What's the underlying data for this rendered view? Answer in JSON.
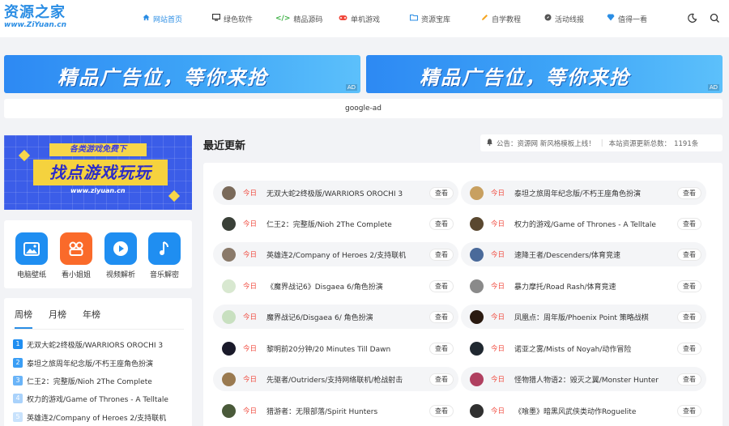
{
  "header": {
    "logo": {
      "cn": "资源之家",
      "en": "www.ZiYuan.cn"
    },
    "nav": [
      {
        "label": "网站首页",
        "icon": "home-icon",
        "active": true
      },
      {
        "label": "绿色软件",
        "icon": "monitor-icon"
      },
      {
        "label": "精品源码",
        "icon": "code-icon"
      },
      {
        "label": "单机游戏",
        "icon": "gamepad-icon"
      },
      {
        "label": "资源宝库",
        "icon": "folder-icon"
      },
      {
        "label": "自学教程",
        "icon": "pencil-icon"
      },
      {
        "label": "活动线报",
        "icon": "compass-icon"
      },
      {
        "label": "值得一看",
        "icon": "diamond-icon"
      }
    ]
  },
  "ads": {
    "text": "精品广告位，等你来抢",
    "tag": "AD",
    "google": "google-ad"
  },
  "sidebar": {
    "banner": {
      "strip": "各类游戏免费下",
      "title": "找点游戏玩玩",
      "url": "www.ziyuan.cn"
    },
    "tools": [
      {
        "label": "电脑壁纸",
        "icon": "image-icon",
        "color": "#1f8ef1"
      },
      {
        "label": "看小姐姐",
        "icon": "video-grid-icon",
        "color": "#fa6a2a"
      },
      {
        "label": "视频解析",
        "icon": "play-icon",
        "color": "#1f8ef1"
      },
      {
        "label": "音乐解密",
        "icon": "music-icon",
        "color": "#1f8ef1"
      }
    ],
    "rank_tabs": [
      "周榜",
      "月榜",
      "年榜"
    ],
    "rank_items": [
      {
        "num": "1",
        "title": "无双大蛇2终极版/WARRIORS OROCHI 3"
      },
      {
        "num": "2",
        "title": "泰坦之旅周年纪念版/不朽王座角色扮演"
      },
      {
        "num": "3",
        "title": "仁王2：完整版/Nioh 2The Complete"
      },
      {
        "num": "4",
        "title": "权力的游戏/Game of Thrones - A Telltale"
      },
      {
        "num": "5",
        "title": "英雄连2/Company of Heroes 2/支持联机"
      }
    ]
  },
  "main": {
    "title": "最近更新",
    "notice": {
      "text": "公告：资源网 新风格模板上线！",
      "total": "本站资源更新总数：",
      "count": "1191条"
    },
    "today": "今日",
    "view": "查看",
    "items": [
      {
        "title": "无双大蛇2终极版/WARRIORS OROCHI 3",
        "color": "#7a6a5a"
      },
      {
        "title": "泰坦之旅周年纪念版/不朽王座角色扮演",
        "color": "#c8a060"
      },
      {
        "title": "仁王2：完整版/Nioh 2The Complete",
        "color": "#3a4038"
      },
      {
        "title": "权力的游戏/Game of Thrones - A Telltale",
        "color": "#5a4830"
      },
      {
        "title": "英雄连2/Company of Heroes 2/支持联机",
        "color": "#8a7a6a"
      },
      {
        "title": "速降王者/Descenders/体育竞速",
        "color": "#4a6a9a"
      },
      {
        "title": "《魔界战记6》Disgaea 6/角色扮演",
        "color": "#d8e8d0"
      },
      {
        "title": "暴力摩托/Road Rash/体育竞速",
        "color": "#8a8a8a"
      },
      {
        "title": "魔界战记6/Disgaea 6/ 角色扮演",
        "color": "#c8e0c0"
      },
      {
        "title": "凤凰点：周年版/Phoenix Point 策略战棋",
        "color": "#2a1a10"
      },
      {
        "title": "黎明前20分钟/20 Minutes Till Dawn",
        "color": "#1a1a2a"
      },
      {
        "title": "诺亚之雾/Mists of Noyah/动作冒险",
        "color": "#202830"
      },
      {
        "title": "先驱者/Outriders/支持网络联机/枪战射击",
        "color": "#9a7a50"
      },
      {
        "title": "怪物猎人物语2：毁灭之翼/Monster Hunter",
        "color": "#b04060"
      },
      {
        "title": "猎游者：无限部落/Spirit Hunters",
        "color": "#4a5a3a"
      },
      {
        "title": "《喰墨》暗黑风武侠类动作Roguelite",
        "color": "#303030"
      }
    ]
  }
}
